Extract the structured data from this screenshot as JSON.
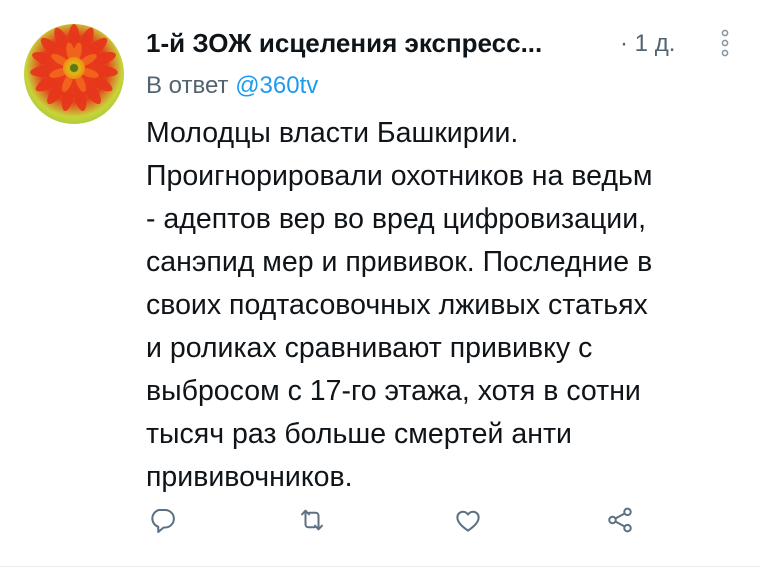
{
  "tweet": {
    "author_name": "1-й ЗОЖ исцеления экспресс...",
    "meta_separator": "·",
    "timestamp": "1 д.",
    "more_icon": "more-vertical-dots-icon",
    "reply_prefix": "В ответ ",
    "reply_handle": "@360tv",
    "text": "Молодцы власти Башкирии.\nПроигнорировали охотников на ведьм\n- адептов вер во вред цифровизации,\nсанэпид мер и прививок. Последние в\nсвоих подтасовочных лживых статьях\nи роликах сравнивают прививку с\nвыбросом с 17-го этажа, хотя в сотни\nтысяч раз больше смертей анти\nпрививочников.",
    "avatar": "red-gerbera-flower-avatar",
    "actions": {
      "reply_icon": "reply-icon",
      "retweet_icon": "retweet-icon",
      "like_icon": "heart-icon",
      "share_icon": "share-icon"
    }
  },
  "colors": {
    "text": "#0f1419",
    "secondary": "#536471",
    "link": "#1d9bf0",
    "icon": "#5b7083"
  }
}
